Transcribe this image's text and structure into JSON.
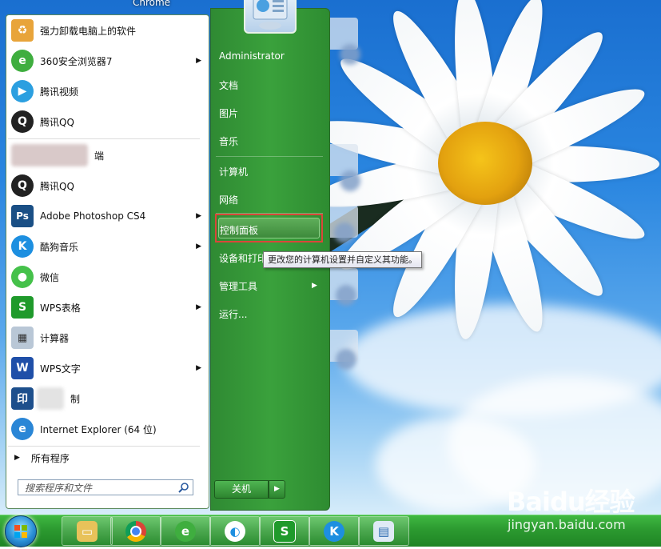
{
  "window_title": "Chrome",
  "start_menu": {
    "programs": [
      {
        "label": "强力卸载电脑上的软件",
        "icon": "uninstaller-icon",
        "submenu": false
      },
      {
        "label": "360安全浏览器7",
        "icon": "360-browser-icon",
        "submenu": true
      },
      {
        "label": "腾讯视频",
        "icon": "tencent-video-icon",
        "submenu": false
      },
      {
        "label": "腾讯QQ",
        "icon": "qq-icon",
        "submenu": false
      },
      {
        "label": "端",
        "icon": "blurred-icon",
        "submenu": false
      },
      {
        "label": "腾讯QQ",
        "icon": "qq-icon",
        "submenu": false
      },
      {
        "label": "Adobe Photoshop CS4",
        "icon": "photoshop-icon",
        "submenu": true
      },
      {
        "label": "酷狗音乐",
        "icon": "kugou-icon",
        "submenu": true
      },
      {
        "label": "微信",
        "icon": "wechat-icon",
        "submenu": false
      },
      {
        "label": "WPS表格",
        "icon": "wps-spreadsheet-icon",
        "submenu": true
      },
      {
        "label": "计算器",
        "icon": "calculator-icon",
        "submenu": false
      },
      {
        "label": "WPS文字",
        "icon": "wps-writer-icon",
        "submenu": true
      },
      {
        "label": "制",
        "icon": "print-icon",
        "submenu": false
      },
      {
        "label": "Internet Explorer (64 位)",
        "icon": "ie-icon",
        "submenu": false
      }
    ],
    "all_programs": "所有程序",
    "search_placeholder": "搜索程序和文件",
    "right_items": [
      {
        "label": "Administrator"
      },
      {
        "label": "文档"
      },
      {
        "label": "图片"
      },
      {
        "label": "音乐"
      },
      {
        "label": "计算机"
      },
      {
        "label": "网络"
      },
      {
        "label": "控制面板"
      },
      {
        "label": "设备和打印"
      },
      {
        "label": "管理工具"
      },
      {
        "label": "运行..."
      }
    ],
    "shutdown_label": "关机",
    "tooltip": "更改您的计算机设置并自定义其功能。"
  },
  "taskbar": {
    "items": [
      "file-explorer-icon",
      "chrome-icon",
      "360-browser-icon",
      "360-guard-icon",
      "wps-spreadsheet-icon",
      "kugou-icon",
      "control-panel-icon"
    ]
  },
  "watermark": {
    "brand": "Baidu经验",
    "url": "jingyan.baidu.com"
  },
  "colors": {
    "menu_green": "#3aa13c",
    "highlight_border": "#d9473a",
    "taskbar_green": "#2c9a30"
  }
}
